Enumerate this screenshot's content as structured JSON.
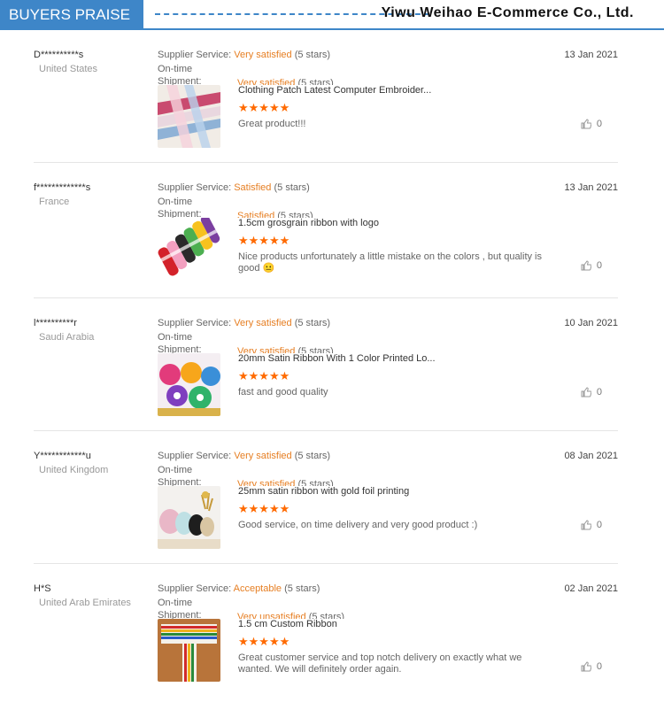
{
  "header": {
    "title": "BUYERS PRAISE",
    "company": "Yiwu Weihao E-Commerce Co., Ltd."
  },
  "labels": {
    "supplier_service": "Supplier Service:",
    "ontime": "On-time",
    "shipment": "Shipment:"
  },
  "reviews": [
    {
      "buyer": "D**********s",
      "country": "United States",
      "supplier_rating": "Very satisfied",
      "supplier_stars": "(5 stars)",
      "shipment_rating": "Very satisfied",
      "shipment_stars": "(5 stars)",
      "product": "Clothing Patch Latest Computer Embroider...",
      "stars": "★★★★★",
      "comment": "Great product!!!",
      "date": "13 Jan 2021",
      "likes": "0"
    },
    {
      "buyer": "f*************s",
      "country": "France",
      "supplier_rating": "Satisfied",
      "supplier_stars": "(5 stars)",
      "shipment_rating": "Satisfied",
      "shipment_stars": "(5 stars)",
      "product": "1.5cm grosgrain ribbon with logo",
      "stars": "★★★★★",
      "comment": "Nice products unfortunately a little mistake on the colors , but quality is good 😐",
      "date": "13 Jan 2021",
      "likes": "0"
    },
    {
      "buyer": "l**********r",
      "country": "Saudi Arabia",
      "supplier_rating": "Very satisfied",
      "supplier_stars": "(5 stars)",
      "shipment_rating": "Very satisfied",
      "shipment_stars": "(5 stars)",
      "product": "20mm Satin Ribbon With 1 Color Printed Lo...",
      "stars": "★★★★★",
      "comment": "fast and good quality",
      "date": "10 Jan 2021",
      "likes": "0"
    },
    {
      "buyer": "Y************u",
      "country": "United Kingdom",
      "supplier_rating": "Very satisfied",
      "supplier_stars": "(5 stars)",
      "shipment_rating": "Very satisfied",
      "shipment_stars": "(5 stars)",
      "product": "25mm satin ribbon with gold foil printing",
      "stars": "★★★★★",
      "comment": "Good service, on time delivery and very good product :)",
      "date": "08 Jan 2021",
      "likes": "0"
    },
    {
      "buyer": "H*S",
      "country": "United Arab Emirates",
      "supplier_rating": "Acceptable",
      "supplier_stars": "(5 stars)",
      "shipment_rating": "Very unsatisfied",
      "shipment_stars": "(5 stars)",
      "product": "1.5 cm Custom Ribbon",
      "stars": "★★★★★",
      "comment": "Great customer service and top notch delivery on exactly what we wanted. We will definitely order again.",
      "date": "02 Jan 2021",
      "likes": "0"
    }
  ],
  "colors": {
    "brand_blue": "#3e86c8",
    "rating_orange": "#e67e22",
    "star_orange": "#ff6a00"
  }
}
